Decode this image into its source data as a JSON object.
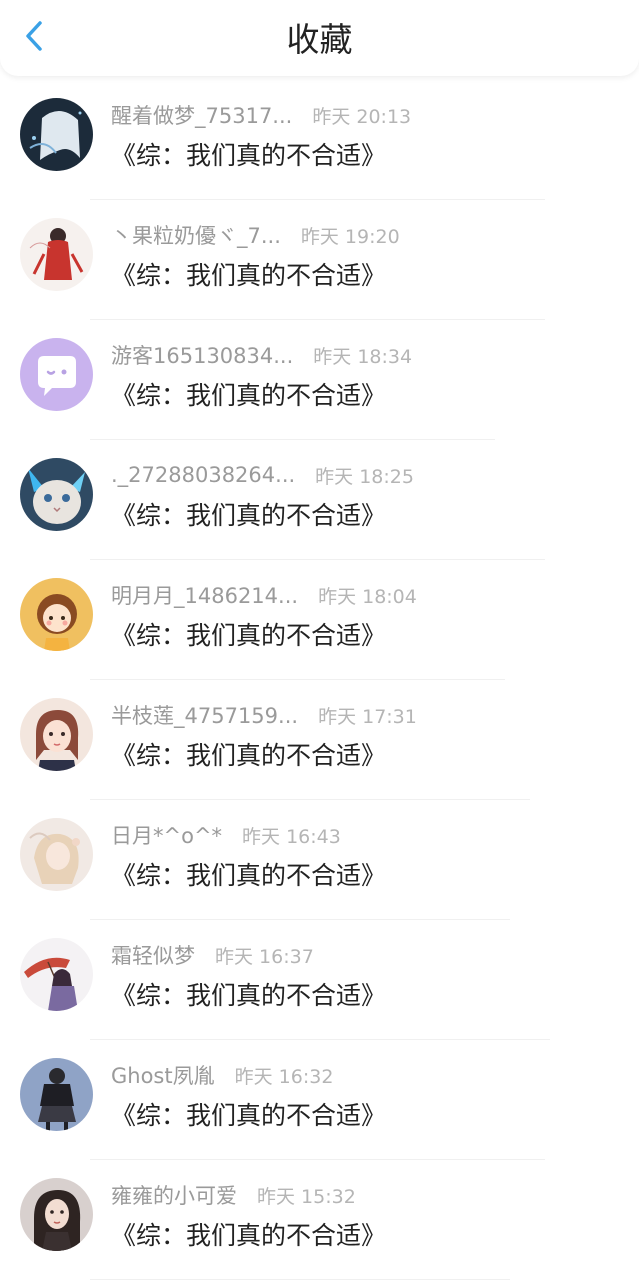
{
  "header": {
    "title": "收藏",
    "back_icon": "chevron-left-icon",
    "accent_color": "#3aa1e6"
  },
  "favorites": [
    {
      "username": "醒着做梦_75317...",
      "time": "昨天 20:13",
      "book": "《综：我们真的不合适》",
      "avatar": "anime-white-hair"
    },
    {
      "username": "丶果粒奶優ヾ_7...",
      "time": "昨天 19:20",
      "book": "《综：我们真的不合适》",
      "avatar": "red-dress-figure"
    },
    {
      "username": "游客165130834...",
      "time": "昨天 18:34",
      "book": "《综：我们真的不合适》",
      "avatar": "default-chat-bubble"
    },
    {
      "username": "._27288038264...",
      "time": "昨天 18:25",
      "book": "《综：我们真的不合适》",
      "avatar": "cat"
    },
    {
      "username": "明月月_1486214...",
      "time": "昨天 18:04",
      "book": "《综：我们真的不合适》",
      "avatar": "cartoon-girl"
    },
    {
      "username": "半枝莲_4757159...",
      "time": "昨天 17:31",
      "book": "《综：我们真的不合适》",
      "avatar": "anime-girl-pink"
    },
    {
      "username": "日月*^o^*",
      "time": "昨天 16:43",
      "book": "《综：我们真的不合适》",
      "avatar": "soft-blonde-figure"
    },
    {
      "username": "霜轻似梦",
      "time": "昨天 16:37",
      "book": "《综：我们真的不合适》",
      "avatar": "umbrella-girl"
    },
    {
      "username": "Ghost夙胤",
      "time": "昨天 16:32",
      "book": "《综：我们真的不合适》",
      "avatar": "dark-outfit-figure"
    },
    {
      "username": "雍雍的小可爱",
      "time": "昨天 15:32",
      "book": "《综：我们真的不合适》",
      "avatar": "portrait-girl"
    }
  ]
}
